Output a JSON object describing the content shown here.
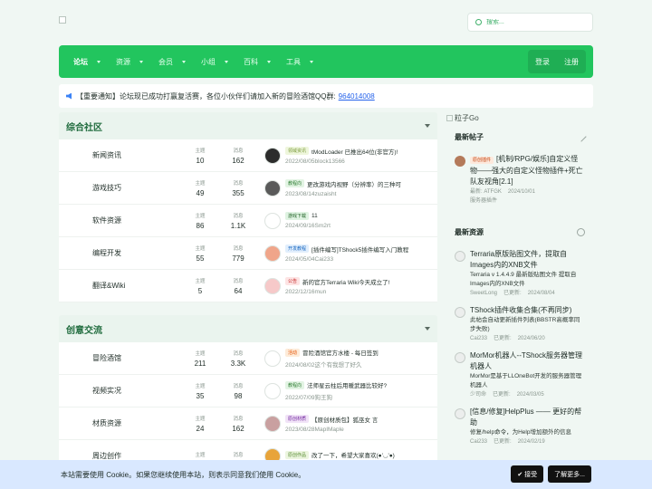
{
  "header": {
    "search_placeholder": "搜索..."
  },
  "nav": {
    "items": [
      {
        "label": "论坛",
        "active": true
      },
      {
        "label": "资源"
      },
      {
        "label": "会员"
      },
      {
        "label": "小组"
      },
      {
        "label": "百科"
      },
      {
        "label": "工具"
      }
    ],
    "login": "登录",
    "register": "注册"
  },
  "notice": {
    "text": "【重要通知】论坛现已成功打赢复活赛，各位小伙伴们请加入新的冒险酒馆QQ群:",
    "link": "964014008"
  },
  "sections": [
    {
      "title": "综合社区",
      "forums": [
        {
          "name": "新闻资讯",
          "threads_label": "主题",
          "threads": "10",
          "posts_label": "消息",
          "posts": "162",
          "tag": "领域资讯",
          "latest": "tModLoader 已推出64位(非官方)!",
          "date": "2022/08/05",
          "user": "block13566",
          "avatar": "#2c2c2c",
          "tagcolor": "#7a9a3a",
          "tagbg": "#eef6dc"
        },
        {
          "name": "游戏技巧",
          "threads_label": "主题",
          "threads": "49",
          "posts_label": "消息",
          "posts": "355",
          "tag": "教程向",
          "latest": "更改游戏内视野（分辨率）的三种可",
          "date": "2023/08/14",
          "user": "zuzaisht",
          "avatar": "#5a5a5a",
          "tagcolor": "#2e7d32",
          "tagbg": "#e3f4e4"
        },
        {
          "name": "软件资源",
          "threads_label": "主题",
          "threads": "86",
          "posts_label": "消息",
          "posts": "1.1K",
          "tag": "游戏下载",
          "latest": "11",
          "date": "2024/09/16",
          "user": "Sm2rt",
          "avatar": "#ffffff",
          "tagcolor": "#1b5e20",
          "tagbg": "#dff3e2"
        },
        {
          "name": "编程开发",
          "threads_label": "主题",
          "threads": "55",
          "posts_label": "消息",
          "posts": "779",
          "tag": "开发教程",
          "latest": "[插件编写]TShock5插件编写入门教程",
          "date": "2024/05/04",
          "user": "Cai233",
          "avatar": "#f0a58a",
          "tagcolor": "#1565c0",
          "tagbg": "#e1eefc"
        },
        {
          "name": "翻译&Wiki",
          "threads_label": "主题",
          "threads": "5",
          "posts_label": "消息",
          "posts": "64",
          "tag": "公告",
          "latest": "新的官方Terraria Wiki今天成立了!",
          "date": "2022/12/16",
          "user": "mun",
          "avatar": "#f6c9c9",
          "tagcolor": "#c62828",
          "tagbg": "#fde4e4"
        }
      ]
    },
    {
      "title": "创意交流",
      "forums": [
        {
          "name": "冒险酒馆",
          "threads_label": "主题",
          "threads": "211",
          "posts_label": "消息",
          "posts": "3.3K",
          "tag": "活动",
          "latest": "冒险酒馆官方水楼 - 每日签到",
          "date": "2024/08/02",
          "user": "这个有我想了好久",
          "avatar": "#ffffff",
          "tagcolor": "#e65100",
          "tagbg": "#fdebd9"
        },
        {
          "name": "视频实况",
          "threads_label": "主题",
          "threads": "35",
          "posts_label": "消息",
          "posts": "98",
          "tag": "教程向",
          "latest": "法师星云柱后用暖武器比较好?",
          "date": "2022/07/09",
          "user": "狗王狗",
          "avatar": "#ffffff",
          "tagcolor": "#2e7d32",
          "tagbg": "#e3f4e4"
        },
        {
          "name": "材质资源",
          "threads_label": "主题",
          "threads": "24",
          "posts_label": "消息",
          "posts": "162",
          "tag": "原创材质",
          "latest": "【原创材质包】狐巫女 言",
          "date": "2023/08/28",
          "user": "MapIMaple",
          "avatar": "#c9a0a0",
          "tagcolor": "#6a1b9a",
          "tagbg": "#f1e3f7"
        },
        {
          "name": "周边创作",
          "threads_label": "主题",
          "threads": "",
          "posts_label": "消息",
          "posts": "",
          "tag": "原创作品",
          "latest": "改了一下，希望大家喜欢(●'◡'●)",
          "date": "",
          "user": "",
          "avatar": "#e8a43a",
          "tagcolor": "#558b2f",
          "tagbg": "#ecf5df"
        }
      ]
    }
  ],
  "sidebar": {
    "image_alt": "粒子Go",
    "latest_posts_title": "最新帖子",
    "latest_posts": [
      {
        "tag": "原创插件",
        "title": "[机制/RPG/娱乐]自定义怪物——强大的自定义怪物插件+死亡队友视角[2.1]",
        "author": "最新: ATFGK",
        "date": "2024/10/01",
        "forum": "服务器插件",
        "avatar": "#b47a5a"
      }
    ],
    "latest_resources_title": "最新资源",
    "resources": [
      {
        "title": "Terraria原版贴图文件，提取自Images内的XNB文件",
        "desc": "Terraria v 1.4.4.9 最新版贴图文件 提取自Images内的XNB文件",
        "author": "SweetLong",
        "updated": "已更新:",
        "date": "2024/08/04"
      },
      {
        "title": "TShock插件收集合集(不再同步)",
        "desc": "此帖会自动更新插件列表(BBSTR高概率同步失败)",
        "author": "Cai233",
        "updated": "已更新:",
        "date": "2024/06/20"
      },
      {
        "title": "MorMor机器人--TShock服务器管理机器人",
        "desc": "MorMor是基于LLOneBot开发的服务器管理机器人",
        "author": "少司命",
        "updated": "已更新:",
        "date": "2024/03/05"
      },
      {
        "title": "[信息/修复]HelpPlus —— 更好的帮助",
        "desc": "修复/help命令，为Help增加额外的信息",
        "author": "Cai233",
        "updated": "已更新:",
        "date": "2024/02/19"
      }
    ]
  },
  "cookie": {
    "message": "本站需要使用 Cookie。如果您继续使用本站，则表示同意我们使用 Cookie。",
    "accept": "✔ 接受",
    "more": "了解更多..."
  }
}
